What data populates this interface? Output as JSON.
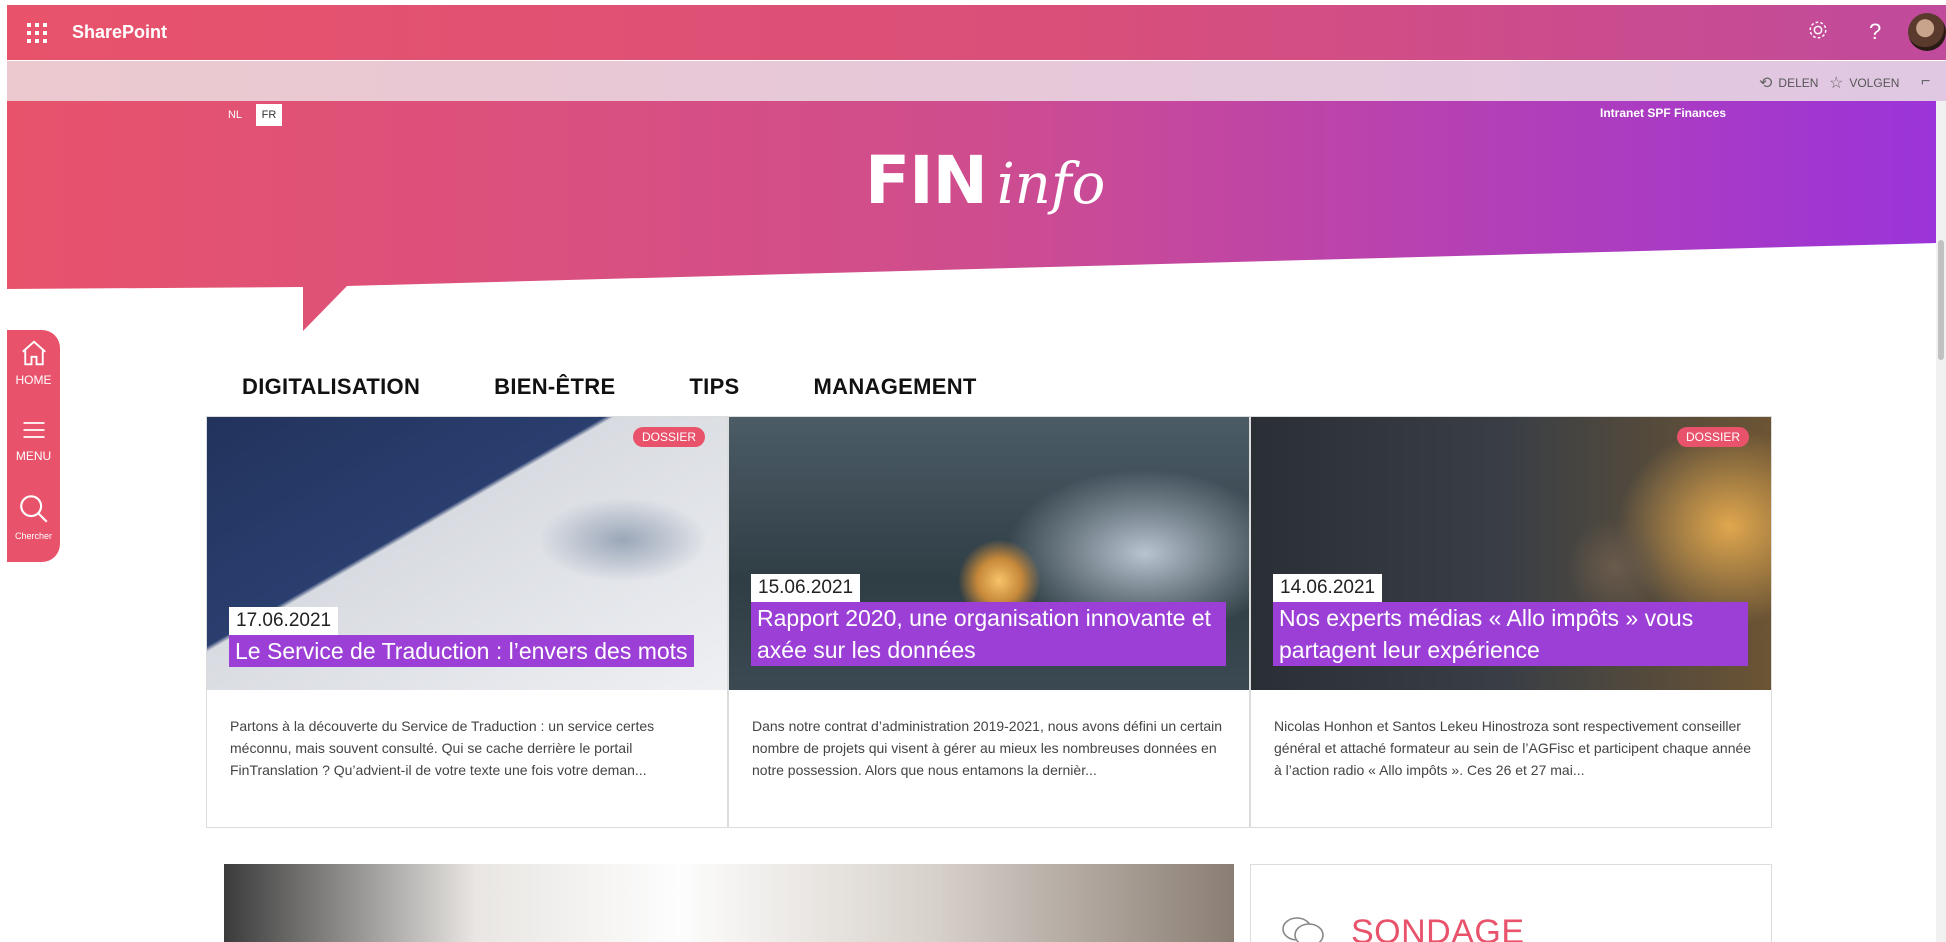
{
  "suitebar": {
    "app_name": "SharePoint",
    "settings_icon": "gear-icon",
    "help_label": "?"
  },
  "commandbar": {
    "share_label": "DELEN",
    "follow_label": "VOLGEN"
  },
  "hero": {
    "lang_nl": "NL",
    "lang_fr": "FR",
    "intranet_label": "Intranet SPF Finances",
    "logo_fin": "FIN",
    "logo_info": "info"
  },
  "sidenav": {
    "home": "HOME",
    "menu": "MENU",
    "search": "Chercher"
  },
  "categories": [
    "DIGITALISATION",
    "BIEN-ÊTRE",
    "TIPS",
    "MANAGEMENT"
  ],
  "cards": [
    {
      "badge": "DOSSIER",
      "date": "17.06.2021",
      "title_lines": [
        "Le Service de Traduction : l’envers des mots"
      ],
      "description": "Partons à la découverte du Service de Traduction : un service certes méconnu, mais souvent consulté. Qui se cache derrière le portail FinTranslation ? Qu’advient-il de votre texte une fois votre deman..."
    },
    {
      "badge": "",
      "date": "15.06.2021",
      "title_lines": [
        "Rapport 2020, une organisation innovante et",
        "axée sur les données"
      ],
      "description": "Dans notre contrat d’administration 2019-2021, nous avons défini un certain nombre de projets qui visent à gérer au mieux les nombreuses données en notre possession. Alors que nous entamons la dernièr..."
    },
    {
      "badge": "DOSSIER",
      "date": "14.06.2021",
      "title_lines": [
        "Nos experts médias « Allo impôts » vous",
        "partagent leur expérience"
      ],
      "description": "Nicolas Honhon et Santos Lekeu Hinostroza sont respectivement conseiller général et attaché formateur au sein de l’AGFisc et participent chaque année à l’action radio « Allo impôts ». Ces 26 et 27 mai..."
    }
  ],
  "sondage": {
    "title": "SONDAGE"
  },
  "colors": {
    "accent": "#e8536b",
    "title_bg": "#9b3fd6",
    "gradient_end": "#9b34d9"
  }
}
